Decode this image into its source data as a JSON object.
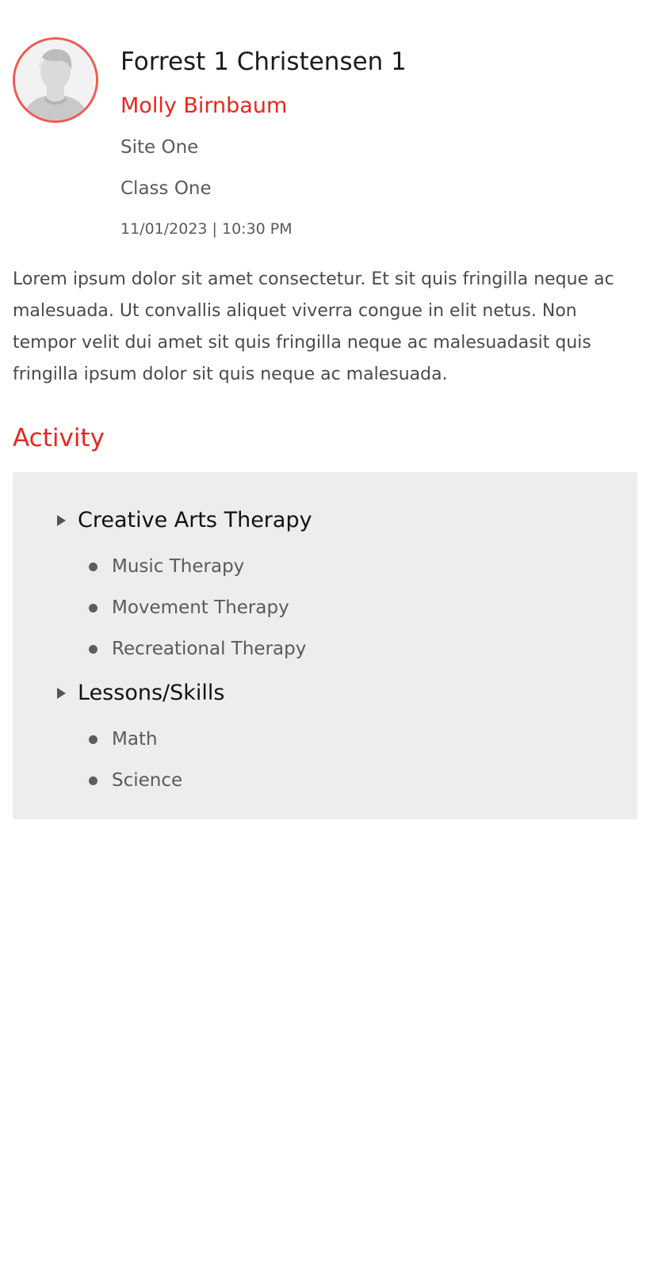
{
  "profile": {
    "avatar_icon": "user-silhouette-icon",
    "name": "Forrest 1 Christensen 1",
    "teacher": "Molly Birnbaum",
    "site": "Site One",
    "class": "Class One",
    "datetime": "11/01/2023 | 10:30 PM"
  },
  "description": "Lorem ipsum dolor sit amet consectetur. Et sit quis fringilla neque ac malesuada. Ut convallis aliquet viverra congue in elit netus. Non tempor velit dui amet sit quis fringilla neque ac malesuadasit quis fringilla ipsum dolor sit quis neque ac malesuada.",
  "activity": {
    "title": "Activity",
    "groups": [
      {
        "label": "Creative Arts Therapy",
        "items": [
          "Music Therapy",
          "Movement Therapy",
          "Recreational Therapy"
        ]
      },
      {
        "label": "Lessons/Skills",
        "items": [
          "Math",
          "Science"
        ]
      }
    ]
  },
  "colors": {
    "accent": "#e8271c",
    "avatar_border": "#f05a50",
    "panel_background": "#eceeed"
  }
}
